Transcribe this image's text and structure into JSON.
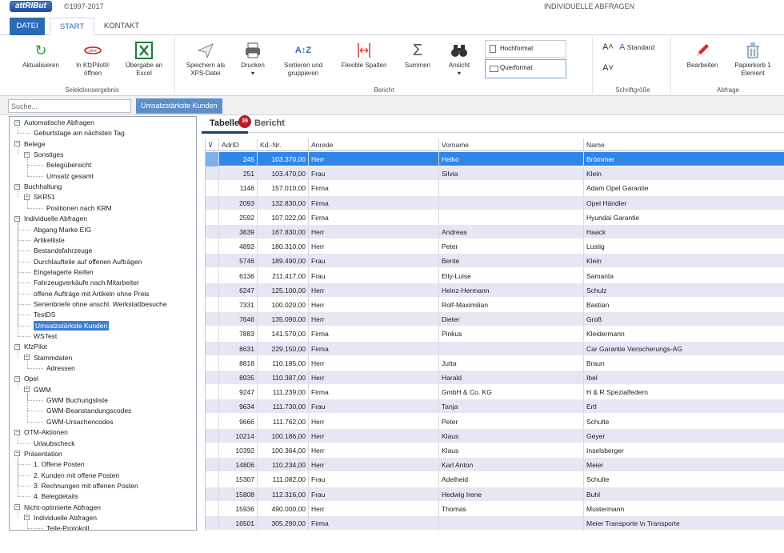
{
  "app": {
    "logo": "attRIBut",
    "copyright": "©1997-2017",
    "title": "INDIVIDUELLE ABFRAGEN"
  },
  "ribbon_tabs": [
    "DATEI",
    "START",
    "KONTAKT"
  ],
  "ribbon": {
    "aktualisieren": "Aktualisieren",
    "kfzpilot": "In KfzPilot® öffnen",
    "excel": "Übergabe an Excel",
    "group_selection": "Selektionsergebnis",
    "xps": "Speichern als XPS-Datei",
    "drucken": "Drucken",
    "sortieren": "Sortieren und gruppieren",
    "flexible": "Flexible Spalten",
    "summen": "Summen",
    "ansicht": "Ansicht",
    "hochformat": "Hochformat",
    "querformat": "Querformat",
    "group_report": "Bericht",
    "standard": "Standard",
    "group_font": "Schriftgröße",
    "bearbeiten": "Bearbeiten",
    "papierkorb": "Papierkorb 1 Element",
    "group_query": "Abfrage"
  },
  "toolbar": {
    "search_placeholder": "Suche...",
    "active_query": "Umsatzstärkste Kunden"
  },
  "tree": [
    {
      "label": "Automatische Abfragen",
      "level": 0,
      "toggle": "−"
    },
    {
      "label": "Geburtstage am nächsten Tag",
      "level": 1
    },
    {
      "label": "Belege",
      "level": 0,
      "toggle": "−"
    },
    {
      "label": "Sonstiges",
      "level": 1,
      "toggle": "−"
    },
    {
      "label": "Belegübersicht",
      "level": 2
    },
    {
      "label": "Umsatz gesamt",
      "level": 2
    },
    {
      "label": "Buchhaltung",
      "level": 0,
      "toggle": "−"
    },
    {
      "label": "SKR51",
      "level": 1,
      "toggle": "−"
    },
    {
      "label": "Positionen nach KRM",
      "level": 2
    },
    {
      "label": "Individuelle Abfragen",
      "level": 0,
      "toggle": "−"
    },
    {
      "label": "Abgang Marke EIG",
      "level": 1
    },
    {
      "label": "Artikelliste",
      "level": 1
    },
    {
      "label": "Bestandsfahrzeuge",
      "level": 1
    },
    {
      "label": "Durchlaufteile auf offenen Aufträgen",
      "level": 1
    },
    {
      "label": "Eingelagerte Reifen",
      "level": 1
    },
    {
      "label": "Fahrzeugverkäufe nach Mitarbeiter",
      "level": 1
    },
    {
      "label": "offene Aufträge mit Artikeln ohne Preis",
      "level": 1
    },
    {
      "label": "Serienbriefe ohne anschl. Werkstattbesuche",
      "level": 1
    },
    {
      "label": "TestDS",
      "level": 1
    },
    {
      "label": "Umsatzstärkste Kunden",
      "level": 1,
      "selected": true
    },
    {
      "label": "WSTest",
      "level": 1
    },
    {
      "label": "KfzPilot",
      "level": 0,
      "toggle": "−"
    },
    {
      "label": "Stammdaten",
      "level": 1,
      "toggle": "−"
    },
    {
      "label": "Adressen",
      "level": 2
    },
    {
      "label": "Opel",
      "level": 0,
      "toggle": "−"
    },
    {
      "label": "GWM",
      "level": 1,
      "toggle": "−"
    },
    {
      "label": "GWM Buchungsliste",
      "level": 2
    },
    {
      "label": "GWM-Beanstandungscodes",
      "level": 2
    },
    {
      "label": "GWM-Ursachencodes",
      "level": 2
    },
    {
      "label": "OTM-Aktionen",
      "level": 0,
      "toggle": "−"
    },
    {
      "label": "Urlaubscheck",
      "level": 1
    },
    {
      "label": "Präsentation",
      "level": 0,
      "toggle": "−"
    },
    {
      "label": "1. Offene Posten",
      "level": 1
    },
    {
      "label": "2. Kunden mit offene Posten",
      "level": 1
    },
    {
      "label": "3. Rechnungen mit offenen Posten",
      "level": 1
    },
    {
      "label": "4. Belegdetails",
      "level": 1
    },
    {
      "label": "Nicht-optimierte Abfragen",
      "level": 0,
      "toggle": "−"
    },
    {
      "label": "Individuelle Abfragen",
      "level": 1,
      "toggle": "−"
    },
    {
      "label": "Teile-Protokoll",
      "level": 2
    }
  ],
  "view_tabs": {
    "tabelle": "Tabelle",
    "count": "39",
    "bericht": "Bericht"
  },
  "table": {
    "columns": [
      "AdrID",
      "Kd.-Nr.",
      "Anrede",
      "Vorname",
      "Name"
    ],
    "rows": [
      [
        "245",
        "103.370,00",
        "Herr",
        "Heiko",
        "Brömmer"
      ],
      [
        "251",
        "103.470,00",
        "Frau",
        "Silvia",
        "Klein"
      ],
      [
        "1146",
        "157.010,00",
        "Firma",
        "",
        "Adam Opel Garantie"
      ],
      [
        "2093",
        "132.830,00",
        "Firma",
        "",
        "Opel Händler"
      ],
      [
        "2592",
        "107.022,00",
        "Firma",
        "",
        "Hyundai Garantie"
      ],
      [
        "3839",
        "167.830,00",
        "Herr",
        "Andreas",
        "Haack"
      ],
      [
        "4892",
        "180.310,00",
        "Herr",
        "Peter",
        "Lustig"
      ],
      [
        "5746",
        "189.490,00",
        "Frau",
        "Bente",
        "Klein"
      ],
      [
        "6136",
        "211.417,00",
        "Frau",
        "Elly-Luise",
        "Samanta"
      ],
      [
        "6247",
        "125.100,00",
        "Herr",
        "Heinz-Hermann",
        "Schulz"
      ],
      [
        "7331",
        "100.020,00",
        "Herr",
        "Rolf-Maximilian",
        "Bastian"
      ],
      [
        "7646",
        "135.090,00",
        "Herr",
        "Dieter",
        "Groß"
      ],
      [
        "7883",
        "141.570,00",
        "Firma",
        "Pinkus",
        "Kleidermann"
      ],
      [
        "8631",
        "229.150,00",
        "Firma",
        "",
        "Car Garantie Versicherungs-AG"
      ],
      [
        "8818",
        "110.185,00",
        "Herr",
        "Jutta",
        "Braun"
      ],
      [
        "8935",
        "110.387,00",
        "Herr",
        "Harald",
        "Ibel"
      ],
      [
        "9247",
        "111.239,00",
        "Firma",
        "GmbH & Co. KG",
        "H & R Spezialfedern"
      ],
      [
        "9634",
        "111.730,00",
        "Frau",
        "Tanja",
        "Ertl"
      ],
      [
        "9666",
        "111.762,00",
        "Herr",
        "Peter",
        "Schulte"
      ],
      [
        "10214",
        "100.186,00",
        "Herr",
        "Klaus",
        "Geyer"
      ],
      [
        "10392",
        "100.364,00",
        "Herr",
        "Klaus",
        "Inselsberger"
      ],
      [
        "14806",
        "110.234,00",
        "Herr",
        "Karl Anton",
        "Meier"
      ],
      [
        "15307",
        "111.082,00",
        "Frau",
        "Adelheid",
        "Schulte"
      ],
      [
        "15808",
        "112.316,00",
        "Frau",
        "Hedwig Irene",
        "Buhl"
      ],
      [
        "15936",
        "490.000,00",
        "Herr",
        "Thomas",
        "Mustermann"
      ],
      [
        "16501",
        "305.290,00",
        "Firma",
        "",
        "Meier Transporte \\n Transporte"
      ]
    ]
  }
}
